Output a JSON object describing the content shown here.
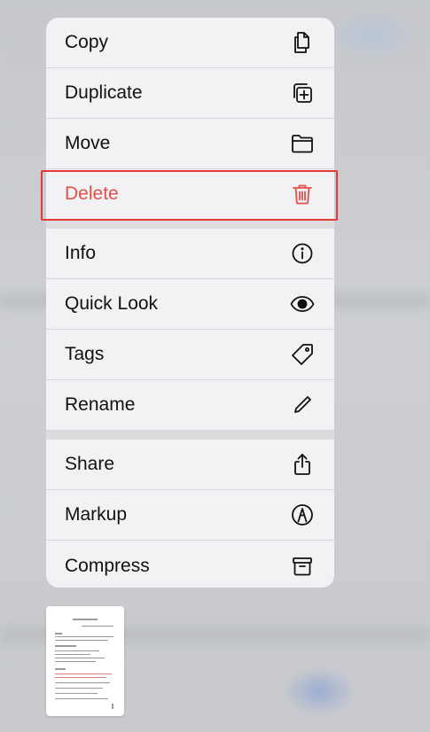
{
  "menu": {
    "groups": [
      [
        {
          "label": "Copy",
          "icon": "doc-on-doc-icon"
        },
        {
          "label": "Duplicate",
          "icon": "plus-square-on-square-icon"
        },
        {
          "label": "Move",
          "icon": "folder-icon"
        },
        {
          "label": "Delete",
          "icon": "trash-icon",
          "destructive": true
        }
      ],
      [
        {
          "label": "Info",
          "icon": "info-circle-icon"
        },
        {
          "label": "Quick Look",
          "icon": "eye-icon"
        },
        {
          "label": "Tags",
          "icon": "tag-icon"
        },
        {
          "label": "Rename",
          "icon": "pencil-icon"
        }
      ],
      [
        {
          "label": "Share",
          "icon": "share-icon"
        },
        {
          "label": "Markup",
          "icon": "markup-icon"
        },
        {
          "label": "Compress",
          "icon": "archive-box-icon"
        }
      ]
    ]
  },
  "colors": {
    "destructive": "#e1504b",
    "highlight_border": "#e53935"
  }
}
